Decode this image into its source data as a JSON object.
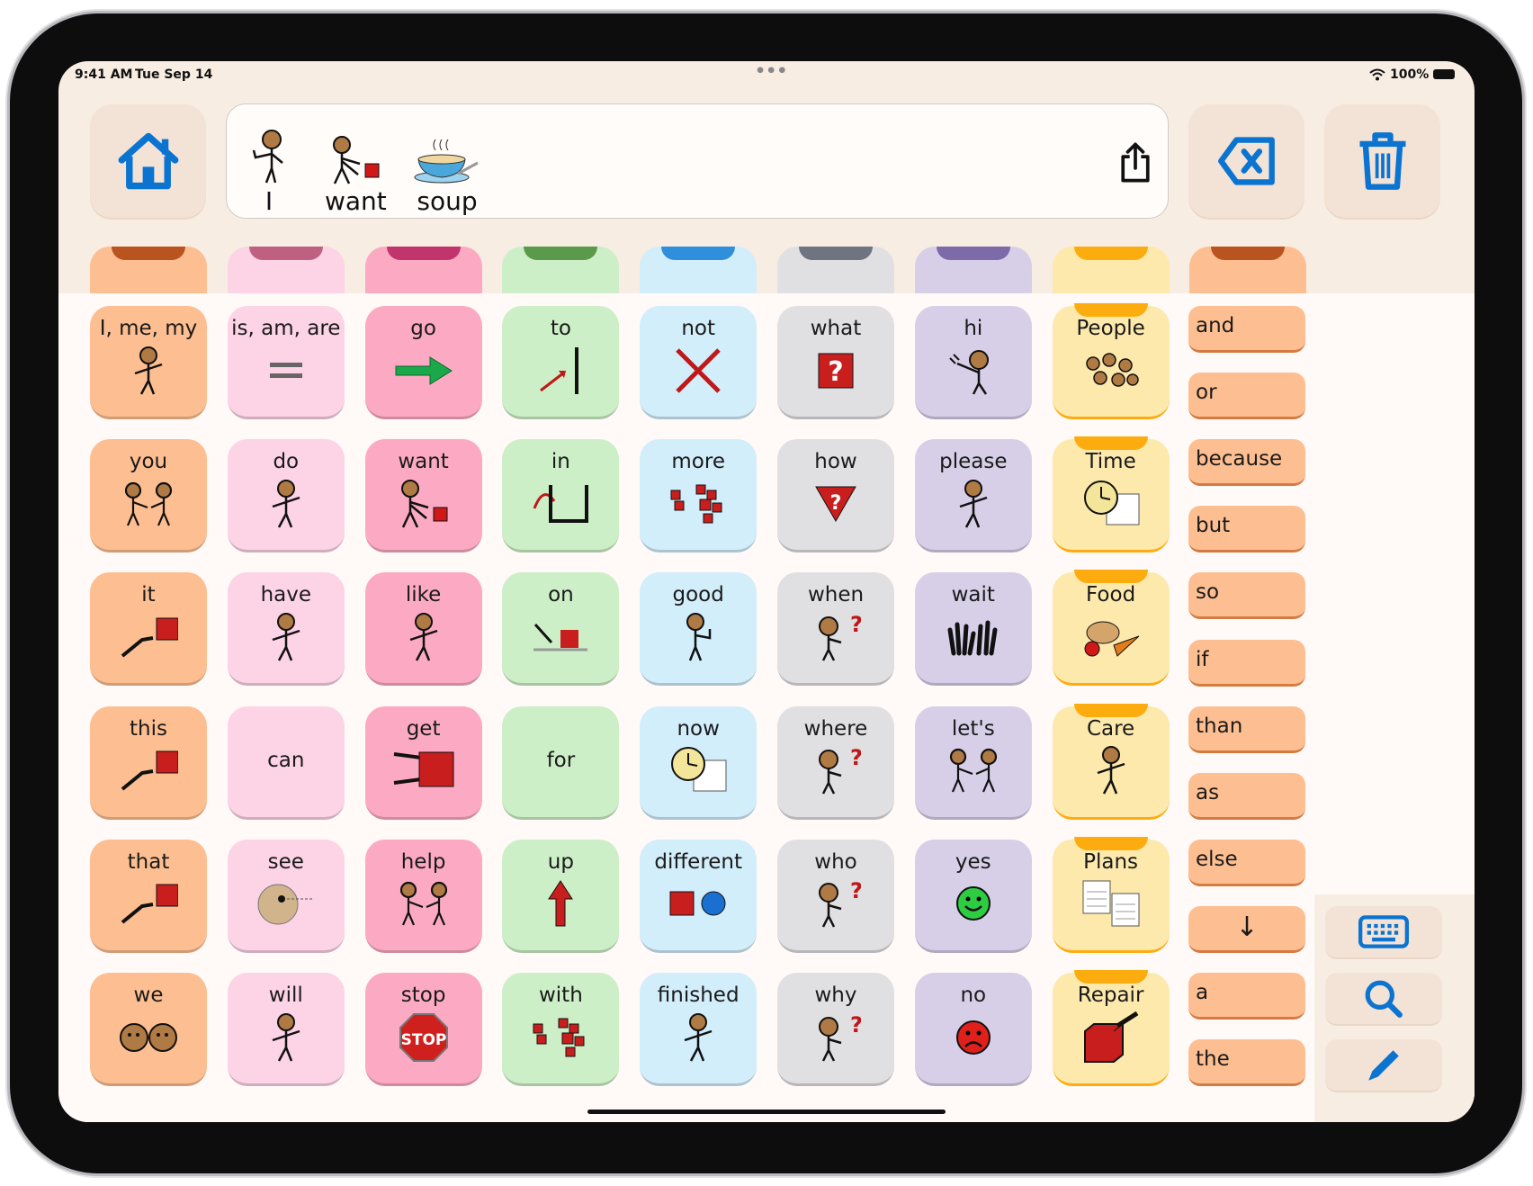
{
  "status": {
    "time": "9:41 AM",
    "date": "Tue Sep 14",
    "battery": "100%"
  },
  "toolbar": {
    "home_icon": "home-icon",
    "share_icon": "share-icon",
    "backspace_icon": "backspace-icon",
    "trash_icon": "trash-icon"
  },
  "message": {
    "words": [
      {
        "text": "I",
        "icon": "person-pointing-self"
      },
      {
        "text": "want",
        "icon": "person-reaching"
      },
      {
        "text": "soup",
        "icon": "soup-bowl"
      }
    ]
  },
  "colors": {
    "accent": "#0a74d0"
  },
  "columns": [
    {
      "bg": "#fdbf91",
      "tab": "#b9531f"
    },
    {
      "bg": "#fdd3e6",
      "tab": "#c06081"
    },
    {
      "bg": "#fcaac4",
      "tab": "#c2356c"
    },
    {
      "bg": "#cdefc7",
      "tab": "#5a9a4a"
    },
    {
      "bg": "#d2eefb",
      "tab": "#2f8fdc"
    },
    {
      "bg": "#e0e0e3",
      "tab": "#6e7580"
    },
    {
      "bg": "#d7cfe8",
      "tab": "#7d6aa8"
    },
    {
      "bg": "#fde9ac",
      "tab": "#fdac10"
    },
    {
      "bg": "#fdbf91",
      "tab": "#b9531f"
    }
  ],
  "grid": [
    [
      {
        "label": "I, me, my",
        "icon": "person"
      },
      {
        "label": "is, am, are",
        "icon": "equals"
      },
      {
        "label": "go",
        "icon": "arrow-right"
      },
      {
        "label": "to",
        "icon": "arrow-to"
      },
      {
        "label": "not",
        "icon": "cross"
      },
      {
        "label": "what",
        "icon": "question-box"
      },
      {
        "label": "hi",
        "icon": "person-waving"
      },
      {
        "label": "People",
        "icon": "people",
        "folder": true
      }
    ],
    [
      {
        "label": "you",
        "icon": "two-people"
      },
      {
        "label": "do",
        "icon": "person"
      },
      {
        "label": "want",
        "icon": "person-reaching"
      },
      {
        "label": "in",
        "icon": "arrow-in"
      },
      {
        "label": "more",
        "icon": "blocks"
      },
      {
        "label": "how",
        "icon": "question-triangle"
      },
      {
        "label": "please",
        "icon": "person"
      },
      {
        "label": "Time",
        "icon": "clock",
        "folder": true
      }
    ],
    [
      {
        "label": "it",
        "icon": "point-square"
      },
      {
        "label": "have",
        "icon": "person"
      },
      {
        "label": "like",
        "icon": "person"
      },
      {
        "label": "on",
        "icon": "arrow-on"
      },
      {
        "label": "good",
        "icon": "person-thumbs"
      },
      {
        "label": "when",
        "icon": "question-person"
      },
      {
        "label": "wait",
        "icon": "hands"
      },
      {
        "label": "Food",
        "icon": "food",
        "folder": true
      }
    ],
    [
      {
        "label": "this",
        "icon": "point-square"
      },
      {
        "label": "can",
        "icon": ""
      },
      {
        "label": "get",
        "icon": "grab-square"
      },
      {
        "label": "for",
        "icon": ""
      },
      {
        "label": "now",
        "icon": "clock"
      },
      {
        "label": "where",
        "icon": "question-person"
      },
      {
        "label": "let's",
        "icon": "two-people"
      },
      {
        "label": "Care",
        "icon": "person",
        "folder": true
      }
    ],
    [
      {
        "label": "that",
        "icon": "point-square"
      },
      {
        "label": "see",
        "icon": "eye-face"
      },
      {
        "label": "help",
        "icon": "two-people"
      },
      {
        "label": "up",
        "icon": "arrow-up"
      },
      {
        "label": "different",
        "icon": "square-circle"
      },
      {
        "label": "who",
        "icon": "question-person"
      },
      {
        "label": "yes",
        "icon": "smile-green"
      },
      {
        "label": "Plans",
        "icon": "plans",
        "folder": true
      }
    ],
    [
      {
        "label": "we",
        "icon": "two-faces"
      },
      {
        "label": "will",
        "icon": "person"
      },
      {
        "label": "stop",
        "icon": "stop-sign"
      },
      {
        "label": "with",
        "icon": "blocks"
      },
      {
        "label": "finished",
        "icon": "person"
      },
      {
        "label": "why",
        "icon": "question-person"
      },
      {
        "label": "no",
        "icon": "frown-red"
      },
      {
        "label": "Repair",
        "icon": "repair-box",
        "folder": true
      }
    ]
  ],
  "connectors": [
    "and",
    "or",
    "because",
    "but",
    "so",
    "if",
    "than",
    "as",
    "else",
    "↓",
    "a",
    "the"
  ],
  "tools": [
    {
      "name": "keyboard",
      "icon": "keyboard-icon"
    },
    {
      "name": "search",
      "icon": "search-icon"
    },
    {
      "name": "edit",
      "icon": "pencil-icon"
    }
  ]
}
